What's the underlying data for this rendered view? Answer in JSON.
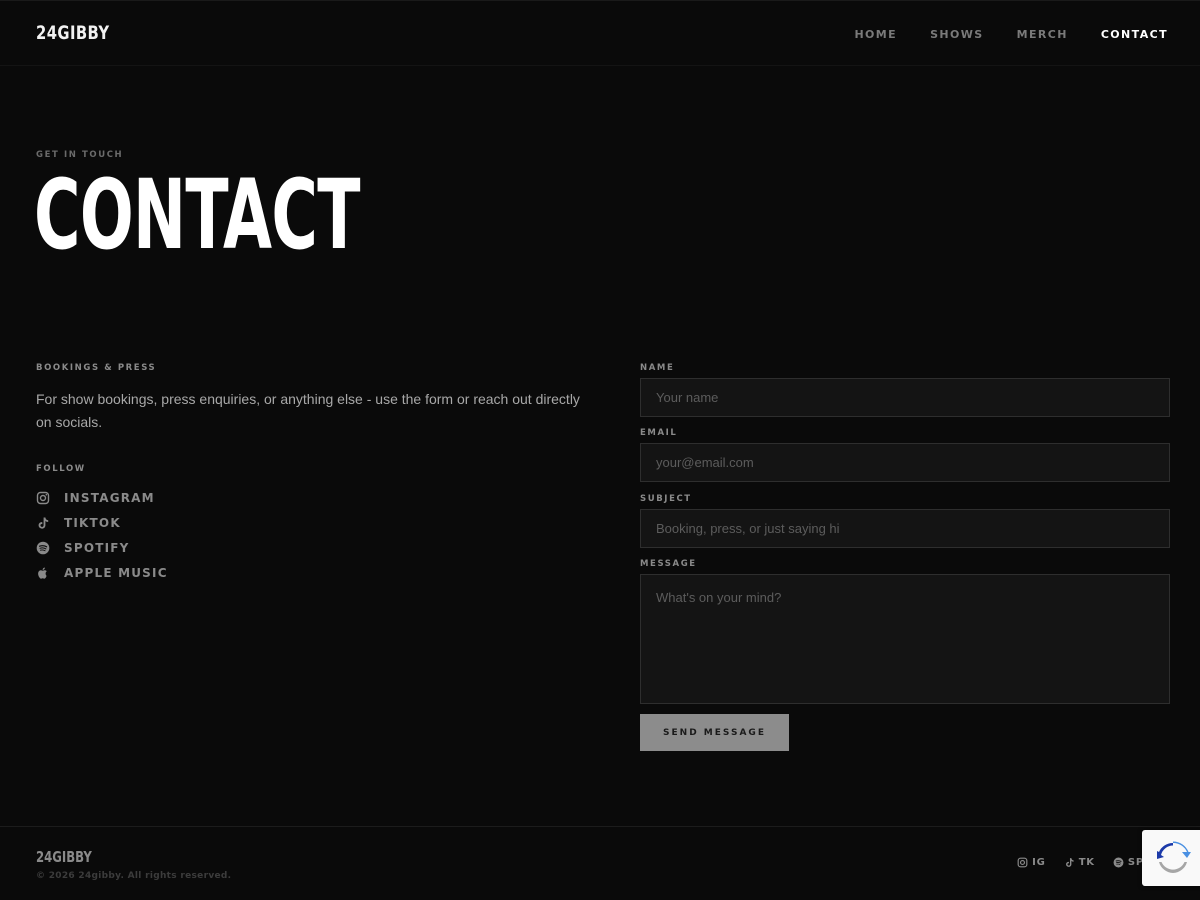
{
  "header": {
    "logo": "24GIBBY",
    "nav": [
      {
        "label": "HOME"
      },
      {
        "label": "SHOWS"
      },
      {
        "label": "MERCH"
      },
      {
        "label": "CONTACT",
        "active": true
      }
    ]
  },
  "hero": {
    "eyebrow": "GET IN TOUCH",
    "title": "CONTACT"
  },
  "info": {
    "bookings_label": "BOOKINGS & PRESS",
    "bookings_text": "For show bookings, press enquiries, or anything else - use the form or reach out directly on socials.",
    "follow_label": "FOLLOW",
    "socials": [
      {
        "label": "INSTAGRAM",
        "icon": "instagram-icon"
      },
      {
        "label": "TIKTOK",
        "icon": "tiktok-icon"
      },
      {
        "label": "SPOTIFY",
        "icon": "spotify-icon"
      },
      {
        "label": "APPLE MUSIC",
        "icon": "apple-icon"
      }
    ]
  },
  "form": {
    "name_label": "NAME",
    "name_placeholder": "Your name",
    "name_value": "",
    "email_label": "EMAIL",
    "email_placeholder": "your@email.com",
    "email_value": "",
    "subject_label": "SUBJECT",
    "subject_placeholder": "Booking, press, or just saying hi",
    "subject_value": "",
    "message_label": "MESSAGE",
    "message_placeholder": "What's on your mind?",
    "message_value": "",
    "submit_label": "SEND MESSAGE"
  },
  "footer": {
    "logo": "24GIBBY",
    "copyright": "© 2026 24gibby. All rights reserved.",
    "socials": [
      {
        "label": "IG",
        "icon": "instagram-icon"
      },
      {
        "label": "TK",
        "icon": "tiktok-icon"
      },
      {
        "label": "SP",
        "icon": "spotify-icon"
      }
    ]
  },
  "colors": {
    "background": "#0a0a0a",
    "input_bg": "#141414",
    "input_border": "#2e2e2e",
    "muted_text": "#8a8a8a",
    "button_bg": "#8c8c8c"
  }
}
